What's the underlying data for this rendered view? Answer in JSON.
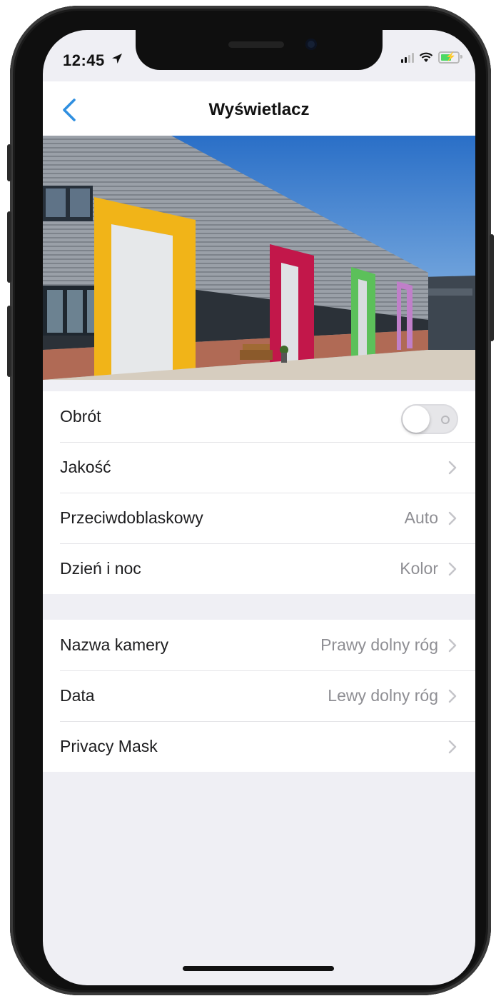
{
  "status_bar": {
    "time": "12:45",
    "location_icon": "location-arrow-icon",
    "signal_icon": "cellular-signal-icon",
    "wifi_icon": "wifi-icon",
    "battery_icon": "battery-charging-icon"
  },
  "nav": {
    "title": "Wyświetlacz",
    "back_icon": "chevron-left-icon"
  },
  "preview": {
    "image_description": "camera preview of industrial warehouse with colored roller doors"
  },
  "section1": [
    {
      "label": "Obrót",
      "type": "toggle",
      "on": false
    },
    {
      "label": "Jakość",
      "value": ""
    },
    {
      "label": "Przeciwdoblaskowy",
      "value": "Auto"
    },
    {
      "label": "Dzień i noc",
      "value": "Kolor"
    }
  ],
  "section2": [
    {
      "label": "Nazwa kamery",
      "value": "Prawy dolny róg"
    },
    {
      "label": "Data",
      "value": "Lewy dolny róg"
    },
    {
      "label": "Privacy Mask",
      "value": ""
    }
  ],
  "colors": {
    "accent": "#2f8fe0",
    "background": "#efeff4",
    "value_text": "#8e8e93",
    "toggle_off": "#e6e6e9"
  }
}
